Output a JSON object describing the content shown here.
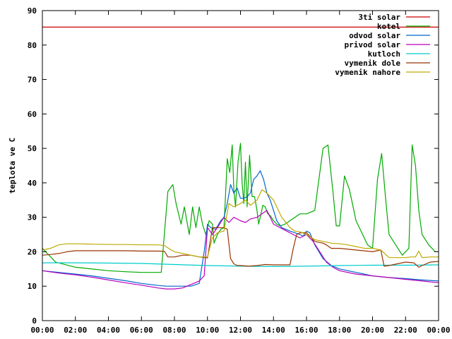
{
  "chart_data": {
    "type": "line",
    "title": "",
    "xlabel": "",
    "ylabel": "teplota ve C",
    "x_ticks": [
      "00:00",
      "02:00",
      "04:00",
      "06:00",
      "08:00",
      "10:00",
      "12:00",
      "14:00",
      "16:00",
      "18:00",
      "20:00",
      "22:00",
      "00:00"
    ],
    "x_range_hours": [
      0,
      24
    ],
    "y_ticks": [
      "0",
      "10",
      "20",
      "30",
      "40",
      "50",
      "60",
      "70",
      "80",
      "90"
    ],
    "ylim": [
      0,
      90
    ],
    "legend_position": "top-right",
    "grid": false,
    "series": [
      {
        "name": "3ti solar",
        "color": "#cc0000",
        "x": [
          0,
          24
        ],
        "y": [
          85.2,
          85.2
        ]
      },
      {
        "name": "kotel",
        "color": "#00aa00",
        "x": [
          0,
          0.8,
          2,
          4,
          5,
          6,
          7.2,
          7.6,
          7.9,
          8.1,
          8.4,
          8.6,
          8.9,
          9.1,
          9.3,
          9.5,
          9.7,
          9.9,
          10.1,
          10.3,
          10.4,
          10.6,
          10.8,
          11,
          11.2,
          11.35,
          11.5,
          11.6,
          11.7,
          11.85,
          12,
          12.1,
          12.2,
          12.3,
          12.4,
          12.55,
          12.7,
          12.85,
          13,
          13.1,
          13.2,
          13.35,
          13.5,
          13.65,
          13.8,
          14,
          14.2,
          14.4,
          14.7,
          15,
          15.3,
          15.6,
          16,
          16.5,
          17,
          17.3,
          17.6,
          17.8,
          18,
          18.3,
          18.6,
          19,
          19.4,
          19.7,
          20,
          20.3,
          20.55,
          20.8,
          21,
          21.4,
          21.8,
          22.2,
          22.4,
          22.6,
          22.8,
          23,
          23.4,
          23.8
        ],
        "y": [
          21,
          17,
          15.5,
          14.5,
          14.2,
          14,
          14,
          37.5,
          39.5,
          34,
          28,
          33,
          25,
          33,
          27,
          33,
          28,
          25,
          29,
          28,
          22.5,
          25,
          26.5,
          27,
          47,
          43,
          51,
          38,
          33,
          46,
          51.5,
          40,
          34,
          46,
          33,
          48,
          36,
          36,
          32,
          28,
          30,
          33.5,
          33,
          31,
          30.5,
          29,
          28,
          27.5,
          28,
          29,
          30,
          31,
          31,
          32,
          50,
          51,
          37.5,
          27.5,
          27.5,
          42,
          38,
          29,
          25,
          22,
          21,
          41,
          48.5,
          35,
          25,
          22,
          19,
          21,
          51,
          45,
          32,
          25,
          22,
          20
        ]
      },
      {
        "name": "odvod solar",
        "color": "#0066cc",
        "x": [
          0,
          1,
          2,
          3,
          4,
          5,
          6,
          7,
          7.5,
          8,
          8.5,
          9,
          9.5,
          9.8,
          10,
          10.2,
          10.5,
          10.8,
          11,
          11.2,
          11.4,
          11.6,
          11.8,
          12,
          12.2,
          12.4,
          12.6,
          12.8,
          13,
          13.2,
          13.4,
          13.6,
          13.8,
          14,
          14.2,
          14.5,
          15,
          15.3,
          15.6,
          15.8,
          16,
          16.2,
          16.5,
          17,
          17.5,
          18,
          19,
          20,
          21,
          22,
          23,
          24
        ],
        "y": [
          14.5,
          14,
          13.5,
          13,
          12.3,
          11.6,
          10.8,
          10.2,
          10,
          10,
          10,
          10,
          10.8,
          20,
          28,
          27,
          26.5,
          29,
          30,
          34,
          39.5,
          37,
          38.5,
          35.5,
          35.5,
          36,
          37,
          41,
          42,
          43.5,
          41,
          37,
          35,
          32,
          29,
          27,
          26,
          25.5,
          25,
          24.5,
          26,
          25.5,
          22,
          18,
          16,
          15,
          14,
          13,
          12.5,
          12.2,
          11.8,
          11.5
        ]
      },
      {
        "name": "privod solar",
        "color": "#bb00bb",
        "x": [
          0,
          1,
          2,
          3,
          4,
          5,
          6,
          7,
          7.5,
          8,
          8.5,
          9,
          9.5,
          9.8,
          10,
          10.3,
          10.6,
          11,
          11.3,
          11.6,
          12,
          12.3,
          12.6,
          13,
          13.3,
          13.6,
          14,
          14.4,
          14.8,
          15.2,
          15.6,
          16,
          16.4,
          16.8,
          17.2,
          17.6,
          18,
          19,
          20,
          21,
          22,
          23,
          24
        ],
        "y": [
          14.5,
          13.8,
          13.3,
          12.6,
          11.8,
          11,
          10.3,
          9.5,
          9.2,
          9.2,
          9.5,
          10.5,
          11.5,
          13,
          27,
          25,
          27,
          30,
          28.5,
          30,
          29,
          28.5,
          29.5,
          30,
          31,
          32,
          28,
          27,
          26,
          25,
          24,
          25,
          23,
          20,
          17,
          15.5,
          14.5,
          13.5,
          13,
          12.5,
          12,
          11.5,
          11
        ]
      },
      {
        "name": "kutloch",
        "color": "#00cccc",
        "x": [
          0,
          2,
          4,
          6,
          8,
          10,
          12,
          14,
          16,
          18,
          20,
          22,
          24
        ],
        "y": [
          16.8,
          16.8,
          16.7,
          16.6,
          16.3,
          16,
          15.8,
          15.7,
          15.8,
          16,
          16.1,
          16.1,
          16.2
        ]
      },
      {
        "name": "vymenik dole",
        "color": "#993300",
        "x": [
          0,
          0.5,
          1,
          1.5,
          2,
          3,
          4,
          5,
          6,
          7,
          7.4,
          7.6,
          8,
          8.5,
          9,
          9.5,
          10,
          10.3,
          10.6,
          11,
          11.2,
          11.4,
          11.6,
          11.8,
          12,
          12.5,
          13,
          13.5,
          14,
          14.5,
          15,
          15.2,
          15.4,
          15.6,
          16,
          16.5,
          17,
          17.2,
          17.5,
          18,
          19,
          20,
          20.5,
          20.7,
          21,
          21.5,
          22,
          22.5,
          22.8,
          23,
          23.5,
          24
        ],
        "y": [
          19,
          19.2,
          19.5,
          20,
          20.3,
          20.3,
          20.3,
          20.3,
          20.2,
          20.2,
          20.1,
          18.5,
          18.5,
          19,
          19,
          18.5,
          18.2,
          27,
          27,
          27,
          26.5,
          18,
          16.5,
          16,
          16,
          15.8,
          16,
          16.3,
          16.2,
          16.2,
          16.2,
          21,
          25,
          25.5,
          25.5,
          23,
          22.5,
          22,
          21,
          21,
          20.5,
          20,
          20.5,
          15.8,
          16,
          16.5,
          17,
          16.8,
          15.5,
          16,
          17,
          17.2
        ]
      },
      {
        "name": "vymenik nahore",
        "color": "#bbaa00",
        "x": [
          0,
          0.5,
          1,
          1.5,
          2,
          3,
          4,
          5,
          6,
          7,
          7.4,
          7.8,
          8,
          8.5,
          9,
          9.5,
          10,
          10.3,
          10.6,
          11,
          11.3,
          11.6,
          12,
          12.3,
          12.6,
          13,
          13.3,
          13.6,
          14,
          14.5,
          15,
          15.3,
          15.6,
          16,
          16.5,
          17,
          17.5,
          18,
          18.5,
          19,
          19.5,
          20,
          20.5,
          21,
          21.5,
          22,
          22.3,
          22.6,
          22.8,
          23,
          23.5,
          24
        ],
        "y": [
          20.5,
          21,
          22,
          22.3,
          22.3,
          22.2,
          22.1,
          22.1,
          22,
          22,
          21.8,
          20.5,
          20,
          19.5,
          19,
          18.5,
          18.5,
          24,
          25.5,
          26,
          34,
          33,
          34,
          35,
          33.5,
          35,
          38,
          37,
          35,
          30,
          27,
          26,
          25.8,
          25,
          23.5,
          23,
          22.5,
          22.3,
          22,
          21.5,
          21,
          21,
          20.5,
          18.3,
          18.3,
          18.3,
          18.5,
          18.5,
          20.2,
          18.3,
          18.5,
          18.5
        ]
      }
    ]
  }
}
